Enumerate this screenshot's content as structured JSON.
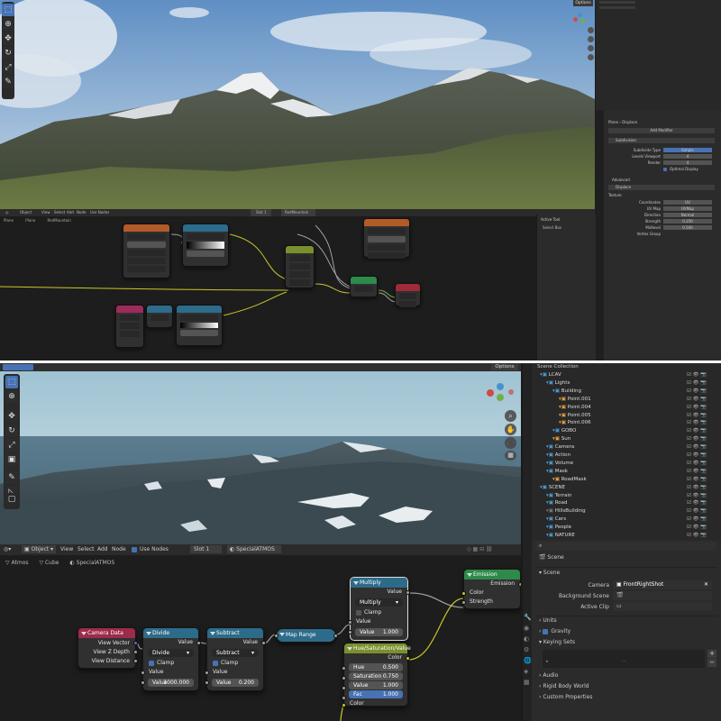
{
  "top_screen": {
    "viewport": {
      "options_label": "Options"
    },
    "node_header": {
      "menus": [
        "Object",
        "View",
        "Select",
        "Add",
        "Node",
        "Use Nodes"
      ],
      "slot": "Slot 1",
      "material": "RedMountain"
    },
    "breadcrumb": [
      "Plane",
      "Plane",
      "RedMountain"
    ],
    "sidepanel": {
      "title": "Active Tool",
      "item": "Select Box"
    },
    "properties": {
      "path": [
        "Plane",
        "Displace"
      ],
      "add_modifier": "Add Modifier",
      "modifier1_name": "Subdivision",
      "modifier1_rows": [
        [
          "Subdivide Type",
          "Simple"
        ],
        [
          "Levels Viewport",
          "4"
        ],
        [
          "Render",
          "4"
        ]
      ],
      "optimal_display": "Optimal Display",
      "advanced": "Advanced",
      "modifier2_name": "Displace",
      "texture_label": "Texture",
      "modifier2_rows": [
        [
          "Coordinates",
          "UV"
        ],
        [
          "UV Map",
          "UVMap"
        ],
        [
          "Direction",
          "Normal"
        ],
        [
          "Strength",
          "0.250"
        ],
        [
          "Midlevel",
          "0.500"
        ],
        [
          "Vertex Group",
          ""
        ]
      ]
    }
  },
  "bottom_screen": {
    "viewport": {
      "options_label": "Options"
    },
    "node_header": {
      "menus": [
        "Object",
        "View",
        "Select",
        "Add",
        "Node"
      ],
      "use_nodes": "Use Nodes",
      "slot": "Slot 1",
      "material": "SpecialATMOS"
    },
    "breadcrumb": [
      "Atmos",
      "Cube",
      "SpecialATMOS"
    ],
    "nodes": {
      "camera_data": {
        "title": "Camera Data",
        "outputs": [
          "View Vector",
          "View Z Depth",
          "View Distance"
        ]
      },
      "divide": {
        "title": "Divide",
        "out": "Value",
        "op": "Divide",
        "clamp": "Clamp",
        "in": "Value",
        "field_label": "Value",
        "field_value": "1000.000"
      },
      "subtract": {
        "title": "Subtract",
        "out": "Value",
        "op": "Subtract",
        "clamp": "Clamp",
        "in": "Value",
        "field_label": "Value",
        "field_value": "0.200"
      },
      "map_range": {
        "title": "Map Range"
      },
      "multiply": {
        "title": "Multiply",
        "out": "Value",
        "op": "Multiply",
        "clamp": "Clamp",
        "in": "Value",
        "field_label": "Value",
        "field_value": "1.000"
      },
      "hsv": {
        "title": "Hue/Saturation/Value",
        "out": "Color",
        "rows": [
          [
            "Hue",
            "0.500"
          ],
          [
            "Saturation",
            "0.750"
          ],
          [
            "Value",
            "1.000"
          ],
          [
            "Fac",
            "1.000"
          ]
        ],
        "in": "Color"
      },
      "emission": {
        "title": "Emission",
        "out": "Emission",
        "inputs": [
          "Color",
          "Strength"
        ]
      }
    },
    "outliner": {
      "title": "Scene Collection",
      "items": [
        {
          "name": "LCAV",
          "color": "#4a9ed6",
          "depth": 1
        },
        {
          "name": "Lights",
          "color": "#4a9ed6",
          "depth": 2
        },
        {
          "name": "Building",
          "color": "#4a9ed6",
          "depth": 3
        },
        {
          "name": "Point.001",
          "color": "#e6a04a",
          "depth": 4
        },
        {
          "name": "Point.004",
          "color": "#e6a04a",
          "depth": 4
        },
        {
          "name": "Point.005",
          "color": "#e6a04a",
          "depth": 4
        },
        {
          "name": "Point.006",
          "color": "#e6a04a",
          "depth": 4
        },
        {
          "name": "GOBO",
          "color": "#4a9ed6",
          "depth": 3
        },
        {
          "name": "Sun",
          "color": "#e6a04a",
          "depth": 3
        },
        {
          "name": "Camera",
          "color": "#4a9ed6",
          "depth": 2
        },
        {
          "name": "Action",
          "color": "#4a9ed6",
          "depth": 2
        },
        {
          "name": "Volume",
          "color": "#4a9ed6",
          "depth": 2
        },
        {
          "name": "Mask",
          "color": "#4a9ed6",
          "depth": 2
        },
        {
          "name": "RoadMask",
          "color": "#e6a04a",
          "depth": 3
        },
        {
          "name": "SCENE",
          "color": "#4a9ed6",
          "depth": 1
        },
        {
          "name": "Terrain",
          "color": "#4a9ed6",
          "depth": 2
        },
        {
          "name": "Road",
          "color": "#4a9ed6",
          "depth": 2
        },
        {
          "name": "HillsBuilding",
          "color": "#7a7a7a",
          "depth": 2
        },
        {
          "name": "Cars",
          "color": "#4a9ed6",
          "depth": 2
        },
        {
          "name": "People",
          "color": "#4a9ed6",
          "depth": 2
        },
        {
          "name": "NATURE",
          "color": "#4a9ed6",
          "depth": 2
        }
      ]
    },
    "properties": {
      "section": "Scene",
      "sub": "Scene",
      "camera_label": "Camera",
      "camera_value": "FrontRightShot",
      "background_label": "Background Scene",
      "active_clip_label": "Active Clip",
      "panels": [
        "Units",
        "Gravity",
        "Keying Sets",
        "Audio",
        "Rigid Body World",
        "Custom Properties"
      ]
    }
  }
}
